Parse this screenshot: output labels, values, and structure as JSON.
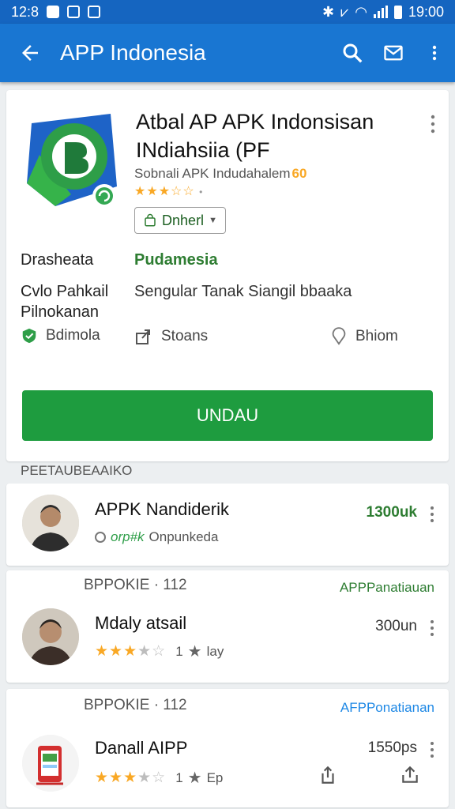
{
  "status_bar": {
    "time_left": "12:8",
    "time_right": "19:00"
  },
  "app_bar": {
    "title": "APP Indonesia"
  },
  "detail": {
    "title": "Atbal AP APK Indonsisan INdiahsiia (PF",
    "developer": "Sobnali APK Indudahalem",
    "developer_badge": "60",
    "rating_stars": "★★★☆☆",
    "rating_dot": "•",
    "chip_label": "Dnherl",
    "row1_label": "Drasheata",
    "row1_value": "Pudamesia",
    "row2_label": "Cvlo Pahkail Pilnokanan",
    "row2_value": "Sengular Tanak Siangil bbaaka",
    "meta1": "Bdimola",
    "meta2": "Stoans",
    "meta3": "Bhiom",
    "install_label": "UNDAU"
  },
  "section_label": "PEETAUBEAAIKO",
  "items": [
    {
      "name": "APPK Nandiderik",
      "price": "1300uk",
      "sub": "Onpunkeda",
      "sub_prefix": "orp#k"
    },
    {
      "head": "BPPOKIE · 112",
      "category": "APPPanatiauan",
      "name": "Mdaly atsail",
      "price": "300un",
      "rating_count": "1",
      "extra": "lay"
    },
    {
      "head": "BPPOKIE · 112",
      "category": "AFPPonatianan",
      "name": "Danall AIPP",
      "price": "1550ps",
      "rating_count": "1",
      "extra": "Ep"
    }
  ],
  "colors": {
    "primary": "#1976d2",
    "status_bar": "#1565c0",
    "install": "#1e9c3f",
    "star": "#f9a825",
    "green_text": "#2e7d32",
    "link_blue": "#1e88e5"
  }
}
